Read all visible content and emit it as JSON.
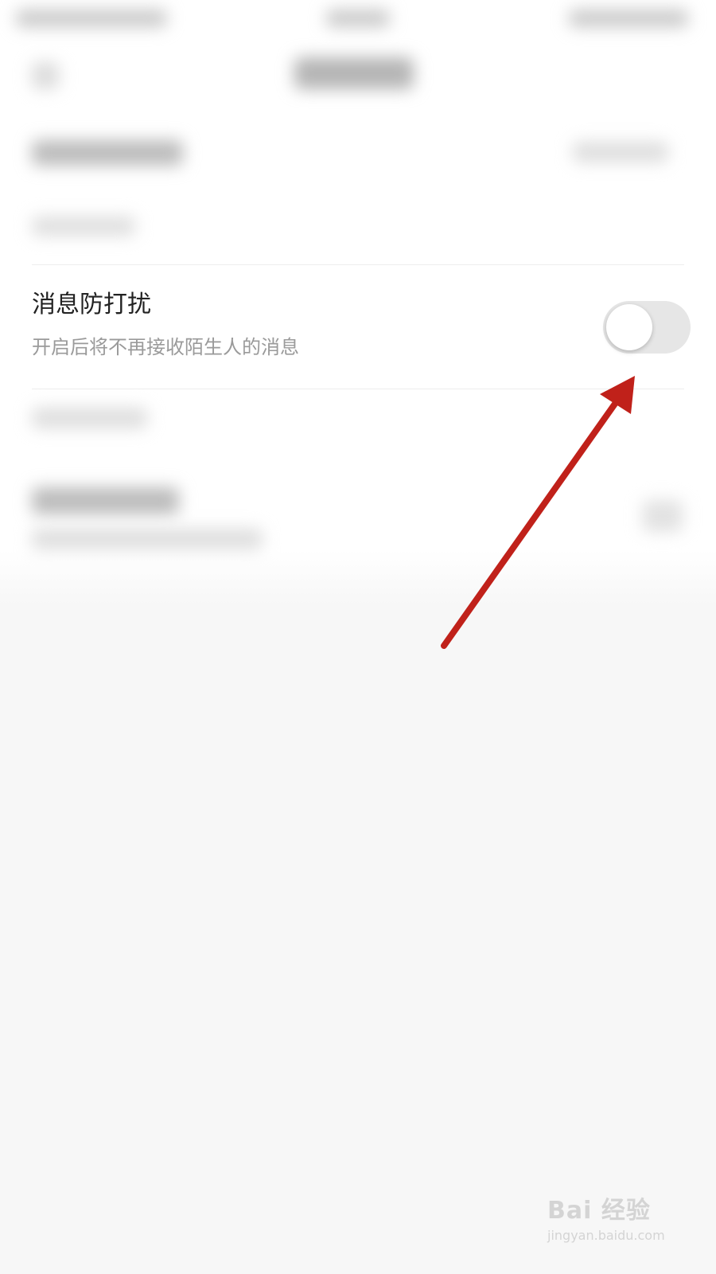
{
  "settings": {
    "dnd": {
      "title": "消息防打扰",
      "description": "开启后将不再接收陌生人的消息",
      "toggle_on": false
    }
  },
  "colors": {
    "toggle_off_track": "#e6e6e6",
    "annotation_arrow": "#c0211a",
    "page_background": "#f7f7f7"
  },
  "watermark": {
    "brand": "Bai 经验",
    "url": "jingyan.baidu.com"
  }
}
